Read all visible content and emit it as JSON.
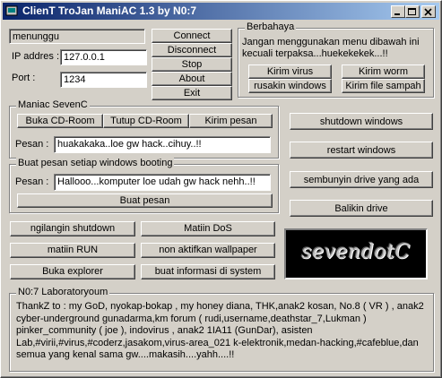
{
  "window": {
    "title": "ClienT TroJan ManiAC 1.3 by N0:7",
    "controls": {
      "minimize": "minimize-icon",
      "maximize": "maximize-icon",
      "close": "close-icon"
    }
  },
  "connection": {
    "status": "menunggu",
    "ip_label": "IP addres :",
    "ip_value": "127.0.0.1",
    "port_label": "Port :",
    "port_value": "1234",
    "buttons": {
      "connect": "Connect",
      "disconnect": "Disconnect",
      "stop": "Stop",
      "about": "About",
      "exit": "Exit"
    }
  },
  "berbahaya": {
    "title": "Berbahaya",
    "warning": "Jangan menggunakan menu dibawah ini\nkecuali terpaksa...huekekekek...!!",
    "buttons": {
      "virus": "Kirim virus",
      "worm": "Kirim worm",
      "rusak": "rusakin windows",
      "sampah": "Kirim file sampah"
    }
  },
  "maniac": {
    "title": "Maniac SevenC",
    "buttons": {
      "buka_cd": "Buka CD-Room",
      "tutup_cd": "Tutup CD-Room",
      "kirim_pesan": "Kirim pesan"
    },
    "pesan_label": "Pesan :",
    "pesan_value": "huakakaka..loe gw hack..cihuy..!!"
  },
  "booting": {
    "title": "Buat pesan setiap windows booting",
    "pesan_label": "Pesan :",
    "pesan_value": "Hallooo...komputer loe udah gw hack nehh..!!",
    "buat_button": "Buat pesan"
  },
  "right_buttons": {
    "shutdown": "shutdown windows",
    "restart": "restart windows",
    "sembunyi": "sembunyin drive yang ada",
    "balikin": "Balikin drive"
  },
  "misc_buttons": {
    "ngilangin": "ngilangin shutdown",
    "matiin_dos": "Matiin DoS",
    "matiin_run": "matiin RUN",
    "wallpaper": "non aktifkan wallpaper",
    "explorer": "Buka explorer",
    "info": "buat informasi di system"
  },
  "logo": {
    "text": "sevendotC"
  },
  "lab": {
    "title": "N0:7 Laboratoryoum",
    "thanks": "ThankZ to : my GoD, nyokap-bokap , my honey diana, THK,anak2 kosan, No.8 ( VR ) , anak2\ncyber-underground gunadarma,km forum ( rudi,username,deathstar_7,Lukman )\npinker_community ( joe ), indovirus , anak2 1IA11 (GunDar), asisten\nLab,#virii,#virus,#coderz,jasakom,virus-area_021 k-elektronik,medan-hacking,#cafeblue,dan\nsemua yang kenal sama gw....makasih....yahh....!!"
  },
  "colors": {
    "titlebar_start": "#0a246a",
    "titlebar_end": "#a6caf0",
    "face": "#d4d0c8",
    "logo_bg": "#000000"
  }
}
